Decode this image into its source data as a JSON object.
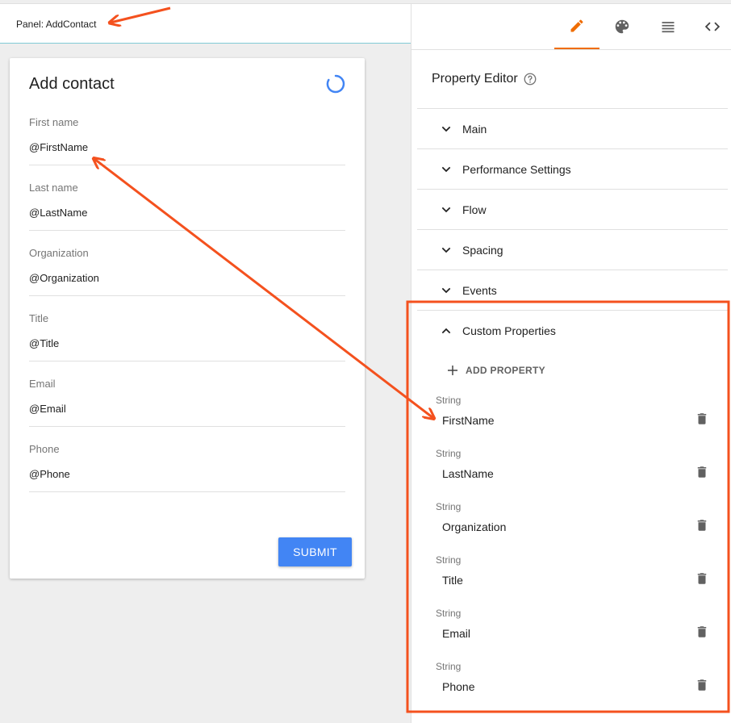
{
  "panel": {
    "title": "Panel: AddContact"
  },
  "form": {
    "title": "Add contact",
    "fields": [
      {
        "label": "First name",
        "value": "@FirstName"
      },
      {
        "label": "Last name",
        "value": "@LastName"
      },
      {
        "label": "Organization",
        "value": "@Organization"
      },
      {
        "label": "Title",
        "value": "@Title"
      },
      {
        "label": "Email",
        "value": "@Email"
      },
      {
        "label": "Phone",
        "value": "@Phone"
      }
    ],
    "submit_label": "SUBMIT"
  },
  "editor": {
    "tabs": [
      {
        "icon": "pencil-icon",
        "active": true
      },
      {
        "icon": "palette-icon",
        "active": false
      },
      {
        "icon": "list-icon",
        "active": false
      },
      {
        "icon": "code-icon",
        "active": false
      }
    ],
    "title": "Property Editor",
    "sections": [
      {
        "label": "Main",
        "expanded": false
      },
      {
        "label": "Performance Settings",
        "expanded": false
      },
      {
        "label": "Flow",
        "expanded": false
      },
      {
        "label": "Spacing",
        "expanded": false
      },
      {
        "label": "Events",
        "expanded": false
      },
      {
        "label": "Custom Properties",
        "expanded": true
      }
    ],
    "add_property_label": "ADD PROPERTY",
    "properties": [
      {
        "type": "String",
        "name": "FirstName"
      },
      {
        "type": "String",
        "name": "LastName"
      },
      {
        "type": "String",
        "name": "Organization"
      },
      {
        "type": "String",
        "name": "Title"
      },
      {
        "type": "String",
        "name": "Email"
      },
      {
        "type": "String",
        "name": "Phone"
      }
    ]
  },
  "colors": {
    "accent": "#ef6c00",
    "primary_button": "#4285f4",
    "annotation": "#f4511e"
  }
}
